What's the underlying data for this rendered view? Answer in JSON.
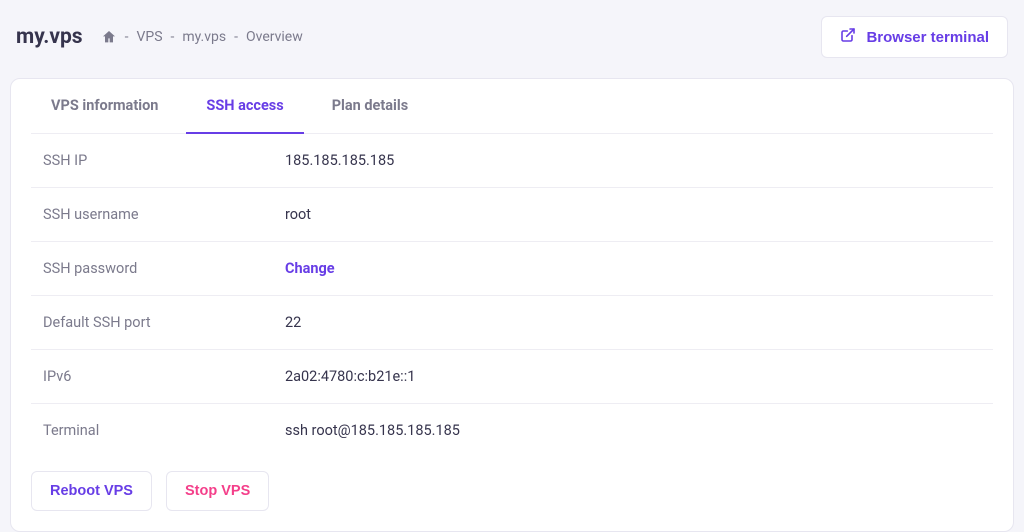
{
  "app": {
    "title": "my.vps"
  },
  "breadcrumb": {
    "items": [
      "VPS",
      "my.vps",
      "Overview"
    ]
  },
  "headerAction": {
    "terminal": "Browser terminal"
  },
  "tabs": {
    "info": "VPS information",
    "ssh": "SSH access",
    "plan": "Plan details"
  },
  "ssh": {
    "rows": {
      "ip": {
        "label": "SSH IP",
        "value": "185.185.185.185"
      },
      "user": {
        "label": "SSH username",
        "value": "root"
      },
      "password": {
        "label": "SSH password",
        "action": "Change"
      },
      "port": {
        "label": "Default SSH port",
        "value": "22"
      },
      "ipv6": {
        "label": "IPv6",
        "value": "2a02:4780:c:b21e::1"
      },
      "terminal": {
        "label": "Terminal",
        "value": "ssh root@185.185.185.185"
      }
    }
  },
  "actions": {
    "reboot": "Reboot VPS",
    "stop": "Stop VPS"
  }
}
